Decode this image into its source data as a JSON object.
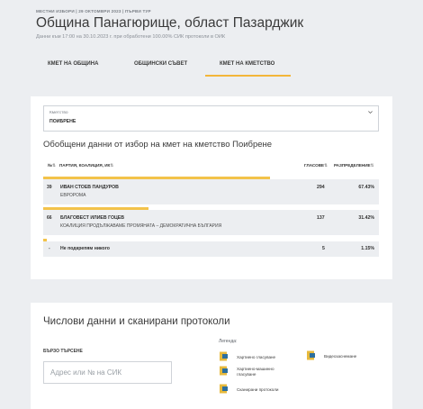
{
  "header": {
    "kicker": "МЕСТНИ ИЗБОРИ | 29 ОКТОМВРИ 2023 | ПЪРВИ ТУР",
    "title": "Община Панагюрище, област Пазарджик",
    "subtitle": "Данни към 17:00 на 30.10.2023 г. при обработени 100.00% СИК протоколи в ОИК"
  },
  "tabs": [
    {
      "label": "КМЕТ НА ОБЩИНА"
    },
    {
      "label": "ОБЩИНСКИ СЪВЕТ"
    },
    {
      "label": "КМЕТ НА КМЕТСТВО",
      "active": true
    }
  ],
  "select": {
    "label": "Кметство",
    "value": "ПОИБРЕНЕ"
  },
  "results": {
    "title": "Обобщени данни от избор на кмет на кметство Поибрене",
    "headers": {
      "num": "№",
      "party": "ПАРТИЯ, КОАЛИЦИЯ, ИК",
      "votes": "ГЛАСОВЕ",
      "share": "РАЗПРЕДЕЛЕНИЕ"
    },
    "rows": [
      {
        "num": "39",
        "name": "ИВАН СТОЕВ ПАНДУРОВ",
        "party": "ЕВРОРОМА",
        "votes": "294",
        "pct": "67.43%",
        "share": 0.6743
      },
      {
        "num": "66",
        "name": "БЛАГОВЕСТ ИЛИЕВ ГОЦЕВ",
        "party": "КОАЛИЦИЯ ПРОДЪЛЖАВАМЕ ПРОМЯНАТА – ДЕМОКРАТИЧНА БЪЛГАРИЯ",
        "votes": "137",
        "pct": "31.42%",
        "share": 0.3142
      },
      {
        "num": "-",
        "name": "Не подкрепям никого",
        "party": "",
        "votes": "5",
        "pct": "1.15%",
        "share": 0.0115
      }
    ]
  },
  "protocols": {
    "title": "Числови данни и сканирани протоколи",
    "quick_search_label": "БЪРЗО ТЪРСЕНЕ",
    "search_placeholder": "Адрес или № на СИК",
    "legend_label": "Легенда:",
    "legend": [
      {
        "text": "Хартиено гласуване",
        "icon": "paper-ballot-icon"
      },
      {
        "text": "Хартиено-машинно гласуване",
        "icon": "paper-machine-ballot-icon"
      },
      {
        "text": "Сканирани протоколи",
        "icon": "scanned-protocol-icon"
      },
      {
        "text": "Видеозаснемане",
        "icon": "video-recording-icon"
      }
    ]
  },
  "colors": {
    "accent": "#f3b63a",
    "row_bg": "#eceef1",
    "icon_yellow": "#e7b93b",
    "icon_blue": "#2d6f9e"
  }
}
